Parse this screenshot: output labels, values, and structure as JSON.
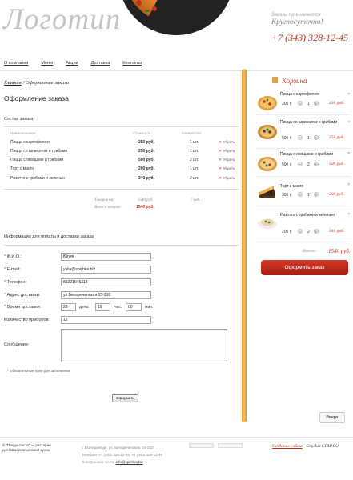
{
  "header": {
    "logo": "Логотип",
    "promo_small": "Заказы принимаются",
    "promo_big": "Круглосуточно!",
    "phone": "+7 (343) 328-12-45"
  },
  "nav": [
    "О компании",
    "Меню",
    "Акции",
    "Доставка",
    "Контакты"
  ],
  "breadcrumb": {
    "home": "Главная",
    "sep": "/",
    "current": "Оформление заказа"
  },
  "page_title": "Оформление заказа",
  "order": {
    "section_title": "Состав заказа",
    "columns": [
      "Наименование:",
      "Стоимость:",
      "Количество:"
    ],
    "rows": [
      {
        "name": "Пицца с картофелем",
        "price": "250 руб.",
        "qty": "1 шт.",
        "del": "Убрать"
      },
      {
        "name": "Пицца со шпинатом и грибами",
        "price": "250 руб.",
        "qty": "1 шт.",
        "del": "Убрать"
      },
      {
        "name": "Пицца с овощами и грибами",
        "price": "500 руб.",
        "qty": "2 шт.",
        "del": "Убрать"
      },
      {
        "name": "Торт с манго",
        "price": "200 руб.",
        "qty": "1 шт.",
        "del": "Убрать"
      },
      {
        "name": "Ризотто с грибами и зеленью",
        "price": "340 руб.",
        "qty": "2 шт.",
        "del": "Убрать"
      }
    ],
    "goods_label": "Товаров на:",
    "goods_value": "1540 руб.",
    "goods_qty": "7 шт.",
    "total_label": "Всего к оплате:",
    "total_value": "1540 руб."
  },
  "form": {
    "section_title": "Информация для оплаты и доставки заказа",
    "req_mark": "*",
    "fio_label": "Ф.И.О.:",
    "fio_value": "Юлия",
    "email_label": "E-mail:",
    "email_value": "yulia@spichka.biz",
    "phone_label": "Телефон:",
    "phone_value": "89221945313",
    "address_label": "Адрес доставки:",
    "address_value": "ул.Белореченская 15-310",
    "time_label": "Время доставки:",
    "time_day": "28",
    "day_label": "день:",
    "time_hour": "19",
    "hour_label": "час.",
    "time_min": "00",
    "min_label": "мин.",
    "devices_label": "Количество приборов:",
    "devices_value": "12",
    "message_label": "Сообщение:",
    "message_value": "",
    "note": "Обязательные поля для заполнения",
    "submit": "Оформить"
  },
  "cart": {
    "title": "Корзина",
    "items": [
      {
        "name": "Пицца с картофелем",
        "weight": "300 г",
        "qty": "1",
        "price": "250 руб."
      },
      {
        "name": "Пицца со шпинатом и грибами",
        "weight": "500 г",
        "qty": "1",
        "price": "250 руб."
      },
      {
        "name": "Пицца с овощами и грибами",
        "weight": "500 г",
        "qty": "2",
        "price": "500 руб."
      },
      {
        "name": "Торт с манго",
        "weight": "300 г",
        "qty": "1",
        "price": "200 руб."
      },
      {
        "name": "Ризотто с грибами и зеленью",
        "weight": "200 г",
        "qty": "2",
        "price": "340 руб."
      }
    ],
    "minus": "–",
    "plus": "+",
    "remove": "×",
    "total_label": "Итого:",
    "total_value": "1540 руб.",
    "order_button": "Оформить заказ"
  },
  "up_button": "Вверх",
  "footer": {
    "copyright": "© \"Пицца-паста\" — ресторан доставки итальянской кухни.",
    "address": "г. Екатеринбург, ул. Белореченская, 15-310",
    "phones": "Телефон: +7 (343) 328-12-45, +7 (343) 328-12-46",
    "email_label": "Электронная почта:",
    "email": "info@spichka.biz",
    "dev_link": "Создание сайта",
    "dev_name": "- Студия СПИЧКА"
  },
  "colors": {
    "accent": "#c3321c",
    "rod": "#f0a83a",
    "muted": "#888888"
  }
}
